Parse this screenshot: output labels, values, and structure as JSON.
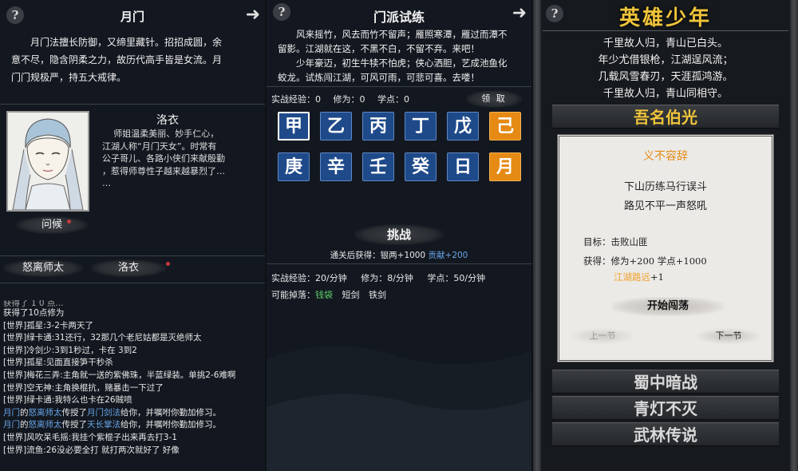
{
  "panel1": {
    "title": "月门",
    "intro_lines": [
      "月门法擅长防御，又缔里藏针。招招成圆，余",
      "意不尽，隐含阴柔之力，故历代高手皆是女流。月",
      "门门规极严，持五大戒律。"
    ],
    "character": {
      "name": "洛衣",
      "desc_lines": [
        "师姐温柔美丽、妙手仁心，",
        "江湖人称“月门天女”。时常有",
        "公子哥儿、各路小侠们来献殷勤",
        "，惹得师尊性子越来越暴烈了…",
        "…"
      ]
    },
    "greet_label": "问候",
    "members": [
      "怒离师太",
      "洛衣"
    ],
    "chat": {
      "partial_line": "获得了 1 0 点...",
      "gain_line": "获得了10点修为",
      "lines": [
        {
          "ch": "[世界]",
          "who": "孤星",
          "msg": ":3-2卡两天了"
        },
        {
          "ch": "[世界]",
          "who": "绿卡通",
          "msg": ":31还行，32那几个老尼姑都是灭绝师太"
        },
        {
          "ch": "[世界]",
          "who": "冷剑少",
          "msg": ":3到1秒过，卡在 3到2"
        },
        {
          "ch": "[世界]",
          "who": "孤星",
          "msg": ":见面直接笋干秒杀"
        },
        {
          "ch": "[世界]",
          "who": "梅花三弄",
          "msg": ":主角就一送的紫佛珠，半蓝绿装。单挑2-6难啊"
        },
        {
          "ch": "[世界]",
          "who": "空无神",
          "msg": ":主角换棍抗，赌暴击一下过了"
        },
        {
          "ch": "[世界]",
          "who": "绿卡通",
          "msg": ":我特么也卡在26贼喷"
        }
      ],
      "sys1": {
        "a": "月门",
        "b": "的",
        "c": "怒离师太",
        "d": "传授了",
        "e": "月门剑法",
        "f": "给你，并嘱咐你勤加修习。"
      },
      "sys2": {
        "a": "月门",
        "b": "的",
        "c": "怒离师太",
        "d": "传授了",
        "e": "天长掌法",
        "f": "给你，并嘱咐你勤加修习。"
      },
      "tail": [
        {
          "ch": "[世界]",
          "who": "风吹呆毛摇",
          "msg": ":我挂个紫棍子出来再去打3-1"
        },
        {
          "ch": "[世界]",
          "who": "流鱼",
          "msg": ":26没必要全打 就打两次就好了 好像"
        }
      ]
    }
  },
  "panel2": {
    "title": "门派试练",
    "intro_lines": [
      "风来摇竹，风去而竹不留声；雁照寒潭，雁过而潭不",
      "留影。江湖就在这，不黑不白，不留不弃。来吧！",
      "少年豪迈，初生牛犊不怕虎；侠心洒胆，艺成池鱼化",
      "蛟龙。试炼闯江湖，可风可雨，可悲可喜。去喽！"
    ],
    "progress": {
      "exp_label": "实战经验：",
      "exp": "0",
      "cult_label": "修为：",
      "cult": "0",
      "pts_label": "学点：",
      "pts": "0",
      "claim": "领 取"
    },
    "tiles": [
      {
        "char": "甲",
        "style": "selected"
      },
      {
        "char": "乙",
        "style": "normal"
      },
      {
        "char": "丙",
        "style": "normal"
      },
      {
        "char": "丁",
        "style": "normal"
      },
      {
        "char": "戊",
        "style": "normal"
      },
      {
        "char": "己",
        "style": "gold"
      },
      {
        "char": "庚",
        "style": "normal"
      },
      {
        "char": "辛",
        "style": "normal"
      },
      {
        "char": "壬",
        "style": "normal"
      },
      {
        "char": "癸",
        "style": "normal"
      },
      {
        "char": "日",
        "style": "normal"
      },
      {
        "char": "月",
        "style": "gold"
      }
    ],
    "challenge": "挑战",
    "reward": {
      "label": "通关后获得：",
      "silver": "银两+1000",
      "contrib": "贡献+200"
    },
    "rates": {
      "exp_label": "实战经验：",
      "exp": "20/分钟",
      "cult_label": "修为：",
      "cult": "8/分钟",
      "pts_label": "学点：",
      "pts": "50/分钟"
    },
    "drops": {
      "label": "可能掉落：",
      "items": [
        "钱袋",
        "短剑",
        "铁剑"
      ]
    }
  },
  "panel3": {
    "title": "英雄少年",
    "poem": [
      "千里故人归，青山已白头。",
      "年少尤借银枪，江湖逞风流；",
      "几载风雪春刃，天涯孤鸿游。",
      "千里故人归，青山同相守。"
    ],
    "chapter": "吾名伯光",
    "quest": {
      "name": "义不容辞",
      "lines": [
        "下山历练马行误斗",
        "路见不平一声怒吼"
      ],
      "target_label": "目标：",
      "target": "击败山匪",
      "gain_label": "获得：",
      "gain": "修为+200 学点+1000",
      "extra": "江湖路远",
      "extra_suffix": "+1",
      "start": "开始闯荡",
      "prev": "上一节",
      "next": "下一节"
    },
    "chapters_below": [
      "蜀中暗战",
      "青灯不灭",
      "武林传说"
    ]
  },
  "colors": {
    "gold": "#e58a14",
    "tile_blue": "#1f4a8a",
    "title_gold": "#f0c43a",
    "link_blue": "#6aa6e8",
    "green": "#5dcf6a"
  }
}
